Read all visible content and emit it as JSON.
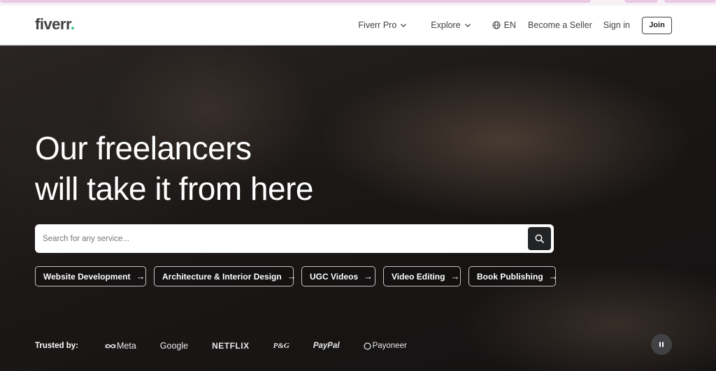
{
  "header": {
    "logo_text": "fiverr",
    "logo_dot": ".",
    "nav": {
      "fiverr_pro": "Fiverr Pro",
      "explore": "Explore",
      "language": "EN",
      "become_seller": "Become a Seller",
      "sign_in": "Sign in",
      "join": "Join"
    }
  },
  "hero": {
    "title_line1": "Our freelancers",
    "title_line2": "will take it from here",
    "search": {
      "placeholder": "Search for any service..."
    },
    "chips": [
      {
        "label": "Website Development",
        "arrow": "→"
      },
      {
        "label": "Architecture & Interior Design",
        "arrow": "→"
      },
      {
        "label": "UGC Videos",
        "arrow": "→"
      },
      {
        "label": "Video Editing",
        "arrow": "→"
      },
      {
        "label": "Book Publishing",
        "arrow": "→"
      }
    ],
    "trusted": {
      "label": "Trusted by:",
      "brands": [
        "Meta",
        "Google",
        "NETFLIX",
        "P&G",
        "PayPal",
        "Payoneer"
      ]
    }
  },
  "icons": {
    "globe": "globe-icon",
    "search": "search-icon",
    "chevron": "chevron-down-icon",
    "pause": "pause-icon"
  },
  "colors": {
    "brand_green": "#1dbf73",
    "text_dark": "#404145",
    "search_button": "#222325"
  }
}
